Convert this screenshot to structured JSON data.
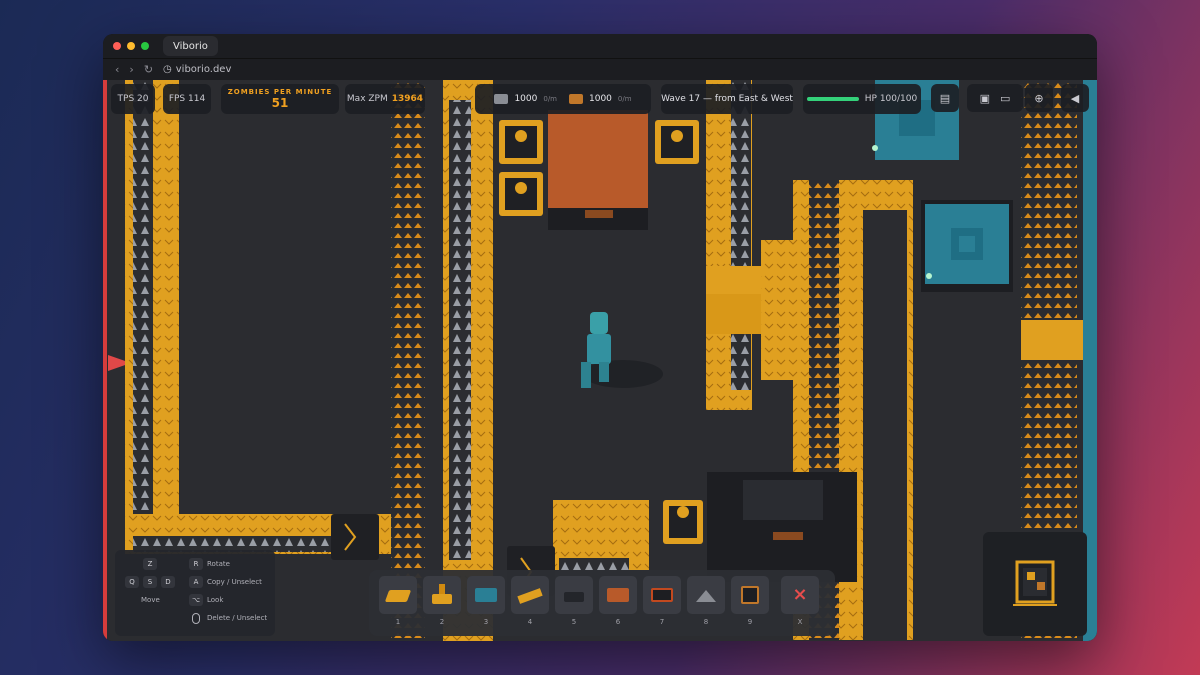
{
  "browser": {
    "tab_title": "Viborio",
    "url": "viborio.dev",
    "traffic_colors": [
      "#ff5f57",
      "#febc2e",
      "#28c840"
    ]
  },
  "hud": {
    "tps": "TPS 20",
    "fps": "FPS 114",
    "zpm_label": "ZOMBIES PER MINUTE",
    "zpm_value": "51",
    "max_zpm_label": "Max ZPM",
    "max_zpm_value": "13964",
    "resource1_amount": "1000",
    "resource1_rate": "0/m",
    "resource2_amount": "1000",
    "resource2_rate": "0/m",
    "wave": "Wave 17 — from East & West",
    "hp_label": "HP 100/100",
    "hp_fraction": 1.0
  },
  "buttons": {
    "notes_icon": "clipboard-icon",
    "save_icon": "save-icon",
    "folder_icon": "folder-icon",
    "zoom_icon": "zoom-icon",
    "sound_icon": "speaker-icon"
  },
  "controls": {
    "keys_move": [
      "Z",
      "Q",
      "S",
      "D"
    ],
    "move_label": "Move",
    "rows": [
      {
        "key": "R",
        "label": "Rotate"
      },
      {
        "key": "A",
        "label": "Copy / Unselect"
      },
      {
        "key": "⌥",
        "label": "Look"
      },
      {
        "key": "mouse",
        "label": "Delete / Unselect"
      }
    ]
  },
  "toolbar": {
    "slots": [
      "1",
      "2",
      "3",
      "4",
      "5",
      "6",
      "7",
      "8",
      "9",
      "X"
    ]
  },
  "colors": {
    "conveyor": "#e0a020",
    "accent_green": "#34d17a",
    "teal_building": "#2a7f95",
    "zombie": "#3aa0a8",
    "delete": "#e74c4c"
  }
}
